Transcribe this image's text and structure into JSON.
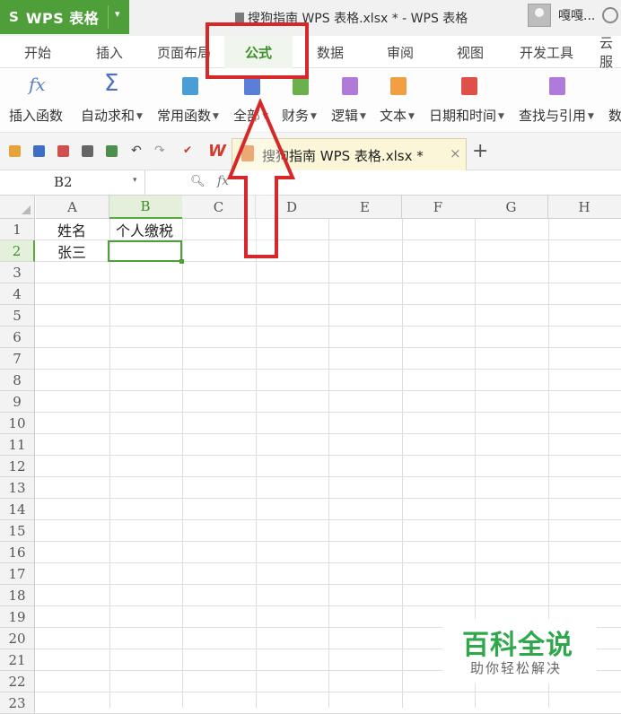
{
  "app": {
    "logo": "S",
    "name": "WPS 表格",
    "caret": "▾"
  },
  "window_title": "搜狗指南  WPS  表格.xlsx * - WPS 表格",
  "user": {
    "name": "嘎嘎..."
  },
  "ribbon_tabs": [
    {
      "label": "开始"
    },
    {
      "label": "插入"
    },
    {
      "label": "页面布局"
    },
    {
      "label": "公式",
      "active": true
    },
    {
      "label": "数据"
    },
    {
      "label": "审阅"
    },
    {
      "label": "视图"
    },
    {
      "label": "开发工具"
    },
    {
      "label": "云服"
    }
  ],
  "ribbon_tools": [
    {
      "label": "插入函数",
      "icon": "fx-icon",
      "dropdown": false
    },
    {
      "label": "自动求和",
      "icon": "sigma-icon",
      "dropdown": true
    },
    {
      "label": "常用函数",
      "icon": "star-icon",
      "dropdown": true,
      "color": "#4a9ed8"
    },
    {
      "label": "全部",
      "icon": "list-icon",
      "dropdown": true,
      "color": "#5b7ed6"
    },
    {
      "label": "财务",
      "icon": "finance-icon",
      "dropdown": true,
      "color": "#6ab04c"
    },
    {
      "label": "逻辑",
      "icon": "question-icon",
      "dropdown": true,
      "color": "#b07ad8"
    },
    {
      "label": "文本",
      "icon": "text-a-icon",
      "dropdown": true,
      "color": "#f0a040"
    },
    {
      "label": "日期和时间",
      "icon": "clock-icon",
      "dropdown": true,
      "color": "#e0504a"
    },
    {
      "label": "查找与引用",
      "icon": "lookup-icon",
      "dropdown": true,
      "color": "#b07ad8"
    },
    {
      "label": "数",
      "icon": "",
      "dropdown": false
    }
  ],
  "document_tab": {
    "name": "搜狗指南  WPS  表格.xlsx *",
    "close": "×"
  },
  "new_tab": "+",
  "wps_logo": "W",
  "formula_bar": {
    "name_box": "B2",
    "fx": "fx",
    "formula": ""
  },
  "columns": [
    "A",
    "B",
    "C",
    "D",
    "E",
    "F",
    "G",
    "H"
  ],
  "selected_column": "B",
  "rows": [
    "1",
    "2",
    "3",
    "4",
    "5",
    "6",
    "7",
    "8",
    "9",
    "10",
    "11",
    "12",
    "13",
    "14",
    "15",
    "16",
    "17",
    "18",
    "19",
    "20",
    "21",
    "22",
    "23"
  ],
  "selected_row": "2",
  "cells": {
    "A1": "姓名",
    "B1": "个人缴税",
    "A2": "张三",
    "B2": ""
  },
  "watermark": {
    "main": "百科全说",
    "sub": "助你轻松解决"
  },
  "colors": {
    "accent": "#4e9e3a",
    "highlight": "#d62828",
    "watermark": "#2ea84a"
  }
}
